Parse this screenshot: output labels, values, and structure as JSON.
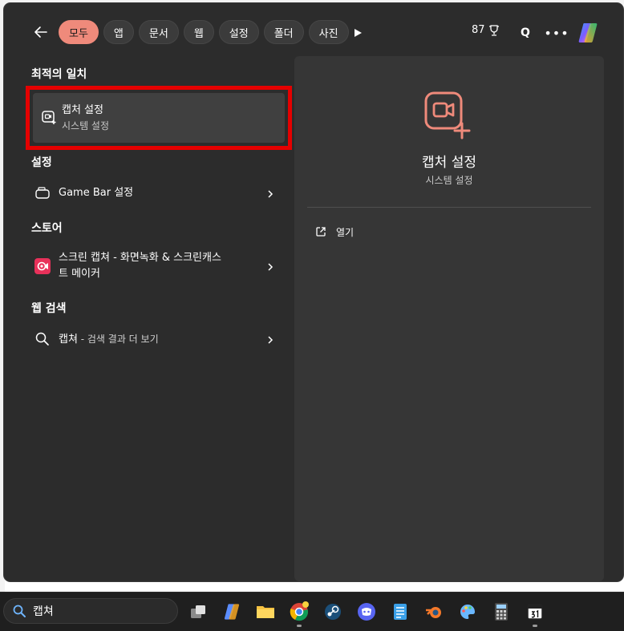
{
  "header": {
    "chips": [
      "모두",
      "앱",
      "문서",
      "웹",
      "설정",
      "폴더",
      "사진"
    ],
    "active_chip": "모두",
    "points": "87"
  },
  "sections": {
    "best_match": "최적의 일치",
    "settings": "설정",
    "store": "스토어",
    "web_search": "웹 검색"
  },
  "best_match": {
    "title": "캡처 설정",
    "subtitle": "시스템 설정"
  },
  "settings_item": {
    "label": "Game Bar 설정"
  },
  "store_item": {
    "line1": "스크린 캡쳐 - 화면녹화 & 스크린캐스",
    "line2": "트 메이커"
  },
  "web_item": {
    "query": "캡쳐",
    "suffix": " - 검색 결과 더 보기"
  },
  "detail": {
    "title": "캡처 설정",
    "subtitle": "시스템 설정",
    "open_label": "열기"
  },
  "taskbar": {
    "search_value": "캡쳐"
  },
  "colors": {
    "accent": "#ef8a7b",
    "highlight_border": "#e50000",
    "panel_bg": "#2c2c2c",
    "detail_bg": "#363636"
  }
}
